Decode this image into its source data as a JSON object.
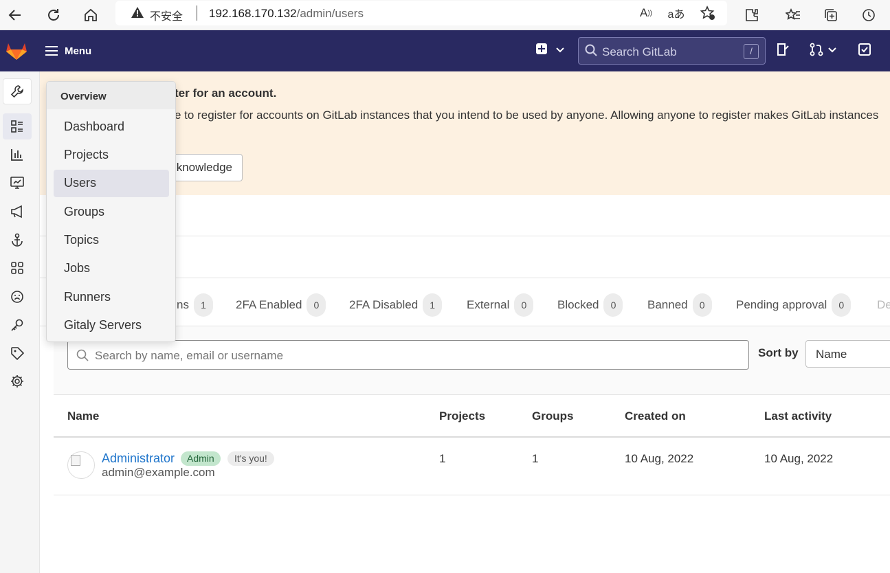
{
  "browser": {
    "insecure_label": "不安全",
    "url_host": "192.168.170.132",
    "url_path": "/admin/users"
  },
  "topnav": {
    "menu_label": "Menu",
    "search_placeholder": "Search GitLab",
    "search_shortcut": "/"
  },
  "banner": {
    "title": "ter for an account.",
    "body": "e to register for accounts on GitLab instances that you intend to be used by anyone. Allowing anyone to register makes GitLab instances",
    "button_label": "knowledge"
  },
  "tabs": [
    {
      "label": "ns",
      "count": "1"
    },
    {
      "label": "2FA Enabled",
      "count": "0"
    },
    {
      "label": "2FA Disabled",
      "count": "1"
    },
    {
      "label": "External",
      "count": "0"
    },
    {
      "label": "Blocked",
      "count": "0"
    },
    {
      "label": "Banned",
      "count": "0"
    },
    {
      "label": "Pending approval",
      "count": "0"
    },
    {
      "label": "De",
      "count": ""
    }
  ],
  "filter": {
    "search_placeholder": "Search by name, email or username",
    "sort_label": "Sort by",
    "sort_value": "Name"
  },
  "table": {
    "headers": [
      "Name",
      "Projects",
      "Groups",
      "Created on",
      "Last activity"
    ],
    "rows": [
      {
        "name": "Administrator",
        "badge_admin": "Admin",
        "badge_you": "It's you!",
        "email": "admin@example.com",
        "projects": "1",
        "groups": "1",
        "created_on": "10 Aug, 2022",
        "last_activity": "10 Aug, 2022"
      }
    ]
  },
  "flyout": {
    "title": "Overview",
    "items": [
      "Dashboard",
      "Projects",
      "Users",
      "Groups",
      "Topics",
      "Jobs",
      "Runners",
      "Gitaly Servers"
    ],
    "active": "Users"
  },
  "colors": {
    "nav_bg": "#292961",
    "banner_bg": "#fdf1e1",
    "link": "#1f75cb",
    "admin_badge_bg": "#c3e6cd"
  }
}
